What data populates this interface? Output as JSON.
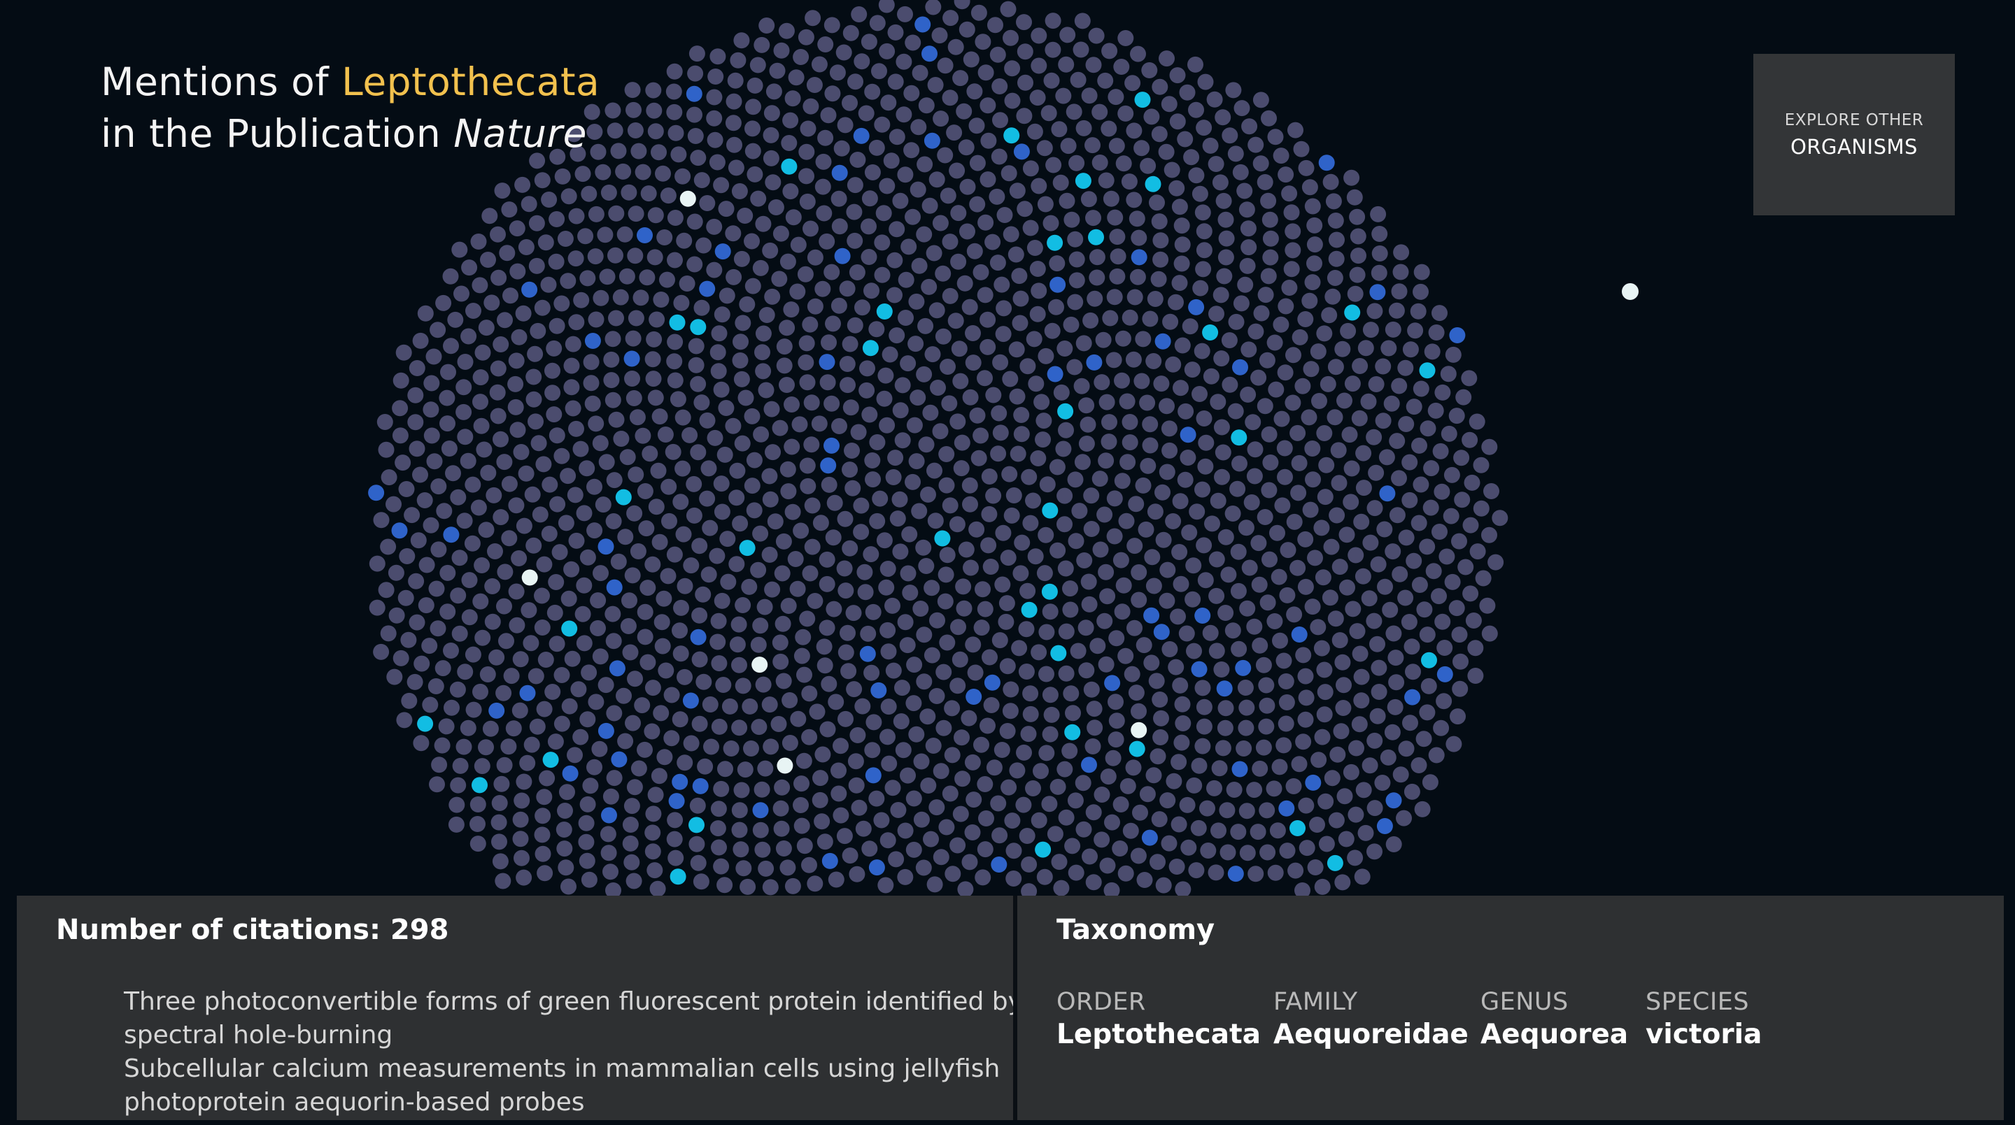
{
  "title": {
    "line1_prefix": "Mentions of ",
    "organism": "Leptothecata",
    "line2_prefix": "in the Publication ",
    "publication": "Nature"
  },
  "explore": {
    "line1": "EXPLORE OTHER",
    "line2": "ORGANISMS"
  },
  "citations": {
    "heading": "Number of citations: 298",
    "items": [
      "Three photoconvertible forms of green fluorescent protein identified by spectral hole-burning",
      "Subcellular calcium measurements in mammalian cells using jellyfish photoprotein aequorin-based probes"
    ]
  },
  "taxonomy": {
    "heading": "Taxonomy",
    "ranks": [
      {
        "rank": "ORDER",
        "value": "Leptothecata"
      },
      {
        "rank": "FAMILY",
        "value": "Aequoreidae"
      },
      {
        "rank": "GENUS",
        "value": "Aequorea"
      },
      {
        "rank": "SPECIES",
        "value": "victoria"
      }
    ]
  },
  "colors": {
    "background": "#040c14",
    "dot_default": "#4b4c6e",
    "dot_blue": "#2f63c9",
    "dot_cyan": "#12bde3",
    "dot_white": "#e8f4f4",
    "highlight": "#f2c14e",
    "panel": "#2e3032"
  }
}
